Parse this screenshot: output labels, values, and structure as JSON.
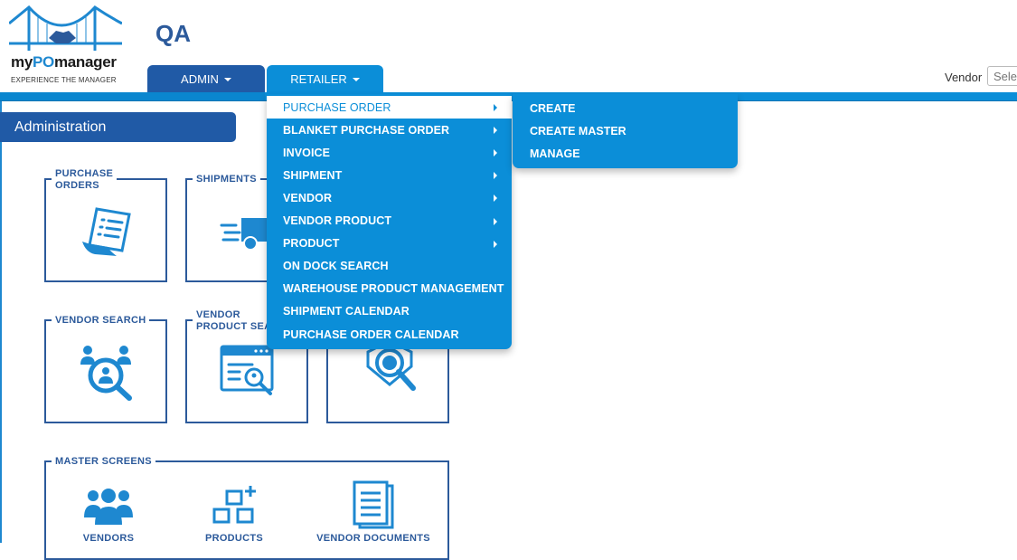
{
  "logo": {
    "brand_prefix": "my",
    "brand_po": "PO",
    "brand_suffix": "manager",
    "tagline": "EXPERIENCE THE MANAGER"
  },
  "environment": "QA",
  "nav": {
    "admin_label": "ADMIN",
    "retailer_label": "RETAILER"
  },
  "vendor": {
    "label": "Vendor",
    "placeholder": "Select"
  },
  "section_title": "Administration",
  "tiles": {
    "purchase_orders": "PURCHASE\nORDERS",
    "shipments": "SHIPMENTS",
    "vendor_search": "VENDOR SEARCH",
    "vendor_product_search": "VENDOR\nPRODUCT SEARCH",
    "master_screens": "MASTER SCREENS",
    "vendors": "VENDORS",
    "products": "PRODUCTS",
    "vendor_documents": "VENDOR DOCUMENTS"
  },
  "retailer_menu": [
    {
      "label": "PURCHASE ORDER",
      "has_submenu": true,
      "active": true
    },
    {
      "label": "BLANKET PURCHASE ORDER",
      "has_submenu": true
    },
    {
      "label": "INVOICE",
      "has_submenu": true
    },
    {
      "label": "SHIPMENT",
      "has_submenu": true
    },
    {
      "label": "VENDOR",
      "has_submenu": true
    },
    {
      "label": "VENDOR PRODUCT",
      "has_submenu": true
    },
    {
      "label": "PRODUCT",
      "has_submenu": true
    },
    {
      "label": "ON DOCK SEARCH",
      "has_submenu": false
    },
    {
      "label": "WAREHOUSE PRODUCT MANAGEMENT",
      "has_submenu": false
    },
    {
      "label": "SHIPMENT CALENDAR",
      "has_submenu": false
    },
    {
      "label": "PURCHASE ORDER CALENDAR",
      "has_submenu": false
    }
  ],
  "purchase_order_submenu": [
    "CREATE",
    "CREATE MASTER",
    "MANAGE"
  ],
  "colors": {
    "primary_dark": "#205aa6",
    "primary_light": "#0b8ed8",
    "icon_blue": "#1e88d0"
  }
}
